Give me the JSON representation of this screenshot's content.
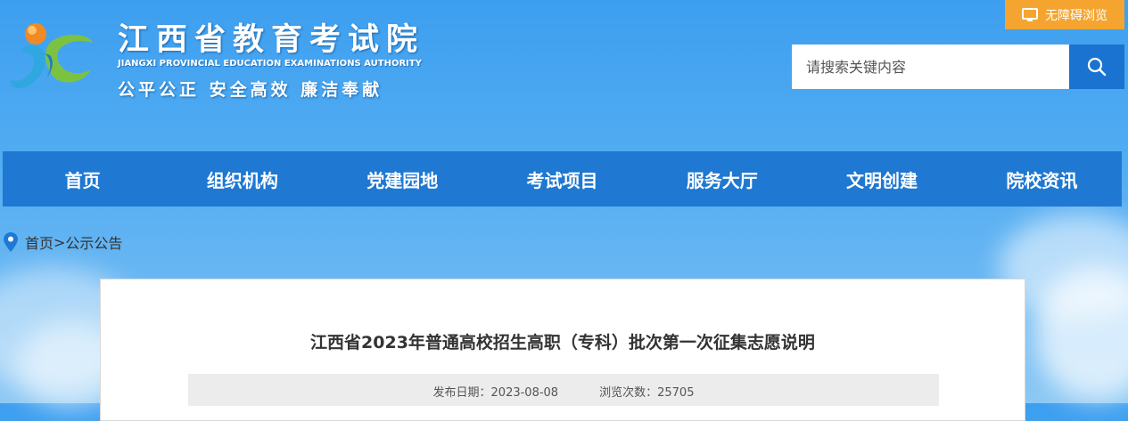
{
  "header": {
    "title": "江西省教育考试院",
    "subtitle_en": "JIANGXI PROVINCIAL EDUCATION EXAMINATIONS AUTHORITY",
    "slogan": "公平公正  安全高效  廉洁奉献",
    "accessibility_label": "无障碍浏览"
  },
  "search": {
    "placeholder": "请搜索关键内容"
  },
  "nav": {
    "items": [
      "首页",
      "组织机构",
      "党建园地",
      "考试项目",
      "服务大厅",
      "文明创建",
      "院校资讯"
    ]
  },
  "breadcrumb": {
    "home": "首页",
    "separator": ">",
    "current": "公示公告"
  },
  "article": {
    "title": "江西省2023年普通高校招生高职（专科）批次第一次征集志愿说明",
    "publish_label": "发布日期：",
    "publish_date": "2023-08-08",
    "views_label": "浏览次数：",
    "views": "25705"
  },
  "colors": {
    "nav_bg": "#1f78d1",
    "accent_orange": "#f5a52f",
    "search_btn": "#1a73d0"
  },
  "icons": {
    "logo": "jx-logo-icon",
    "access": "monitor-icon",
    "search": "search-icon",
    "location": "location-pin-icon"
  }
}
